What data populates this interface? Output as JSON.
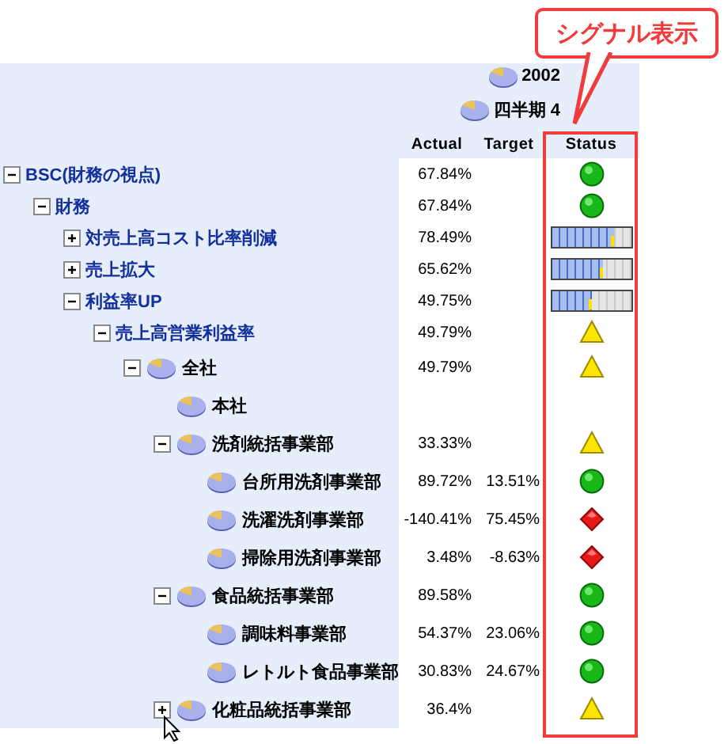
{
  "callout": {
    "text": "シグナル表示"
  },
  "header": {
    "year": "2002",
    "quarter": "四半期 4",
    "columns": [
      "Actual",
      "Target",
      "Status"
    ]
  },
  "tree": [
    {
      "label": "BSC(財務の視点)",
      "kind": "measure",
      "expanded": true,
      "actual": "67.84%",
      "status": {
        "kind": "circle"
      },
      "children": [
        {
          "label": "財務",
          "kind": "measure",
          "expanded": true,
          "actual": "67.84%",
          "status": {
            "kind": "circle"
          },
          "children": [
            {
              "label": "対売上高コスト比率削減",
              "kind": "measure",
              "expanded": false,
              "actual": "78.49%",
              "status": {
                "kind": "gauge",
                "level": 0.78
              }
            },
            {
              "label": "売上拡大",
              "kind": "measure",
              "expanded": false,
              "actual": "65.62%",
              "status": {
                "kind": "gauge",
                "level": 0.65
              }
            },
            {
              "label": "利益率UP",
              "kind": "measure",
              "expanded": true,
              "actual": "49.75%",
              "status": {
                "kind": "gauge",
                "level": 0.5
              },
              "children": [
                {
                  "label": "売上高営業利益率",
                  "kind": "measure",
                  "expanded": true,
                  "actual": "49.79%",
                  "status": {
                    "kind": "triangle"
                  },
                  "children": [
                    {
                      "label": "全社",
                      "kind": "org",
                      "expanded": true,
                      "actual": "49.79%",
                      "status": {
                        "kind": "triangle"
                      },
                      "children": [
                        {
                          "label": "本社",
                          "kind": "org"
                        },
                        {
                          "label": "洗剤統括事業部",
                          "kind": "org",
                          "expanded": true,
                          "actual": "33.33%",
                          "status": {
                            "kind": "triangle"
                          },
                          "children": [
                            {
                              "label": "台所用洗剤事業部",
                              "kind": "org",
                              "actual": "89.72%",
                              "target": "13.51%",
                              "status": {
                                "kind": "circle"
                              }
                            },
                            {
                              "label": "洗濯洗剤事業部",
                              "kind": "org",
                              "actual": "-140.41%",
                              "target": "75.45%",
                              "status": {
                                "kind": "diamond"
                              }
                            },
                            {
                              "label": "掃除用洗剤事業部",
                              "kind": "org",
                              "actual": "3.48%",
                              "target": "-8.63%",
                              "status": {
                                "kind": "diamond"
                              }
                            }
                          ]
                        },
                        {
                          "label": "食品統括事業部",
                          "kind": "org",
                          "expanded": true,
                          "actual": "89.58%",
                          "status": {
                            "kind": "circle"
                          },
                          "children": [
                            {
                              "label": "調味料事業部",
                              "kind": "org",
                              "actual": "54.37%",
                              "target": "23.06%",
                              "status": {
                                "kind": "circle"
                              }
                            },
                            {
                              "label": "レトルト食品事業部",
                              "kind": "org",
                              "actual": "30.83%",
                              "target": "24.67%",
                              "status": {
                                "kind": "circle"
                              }
                            }
                          ]
                        },
                        {
                          "label": "化粧品統括事業部",
                          "kind": "org",
                          "expanded": false,
                          "actual": "36.4%",
                          "status": {
                            "kind": "triangle"
                          }
                        }
                      ]
                    }
                  ]
                }
              ]
            }
          ]
        }
      ]
    }
  ]
}
